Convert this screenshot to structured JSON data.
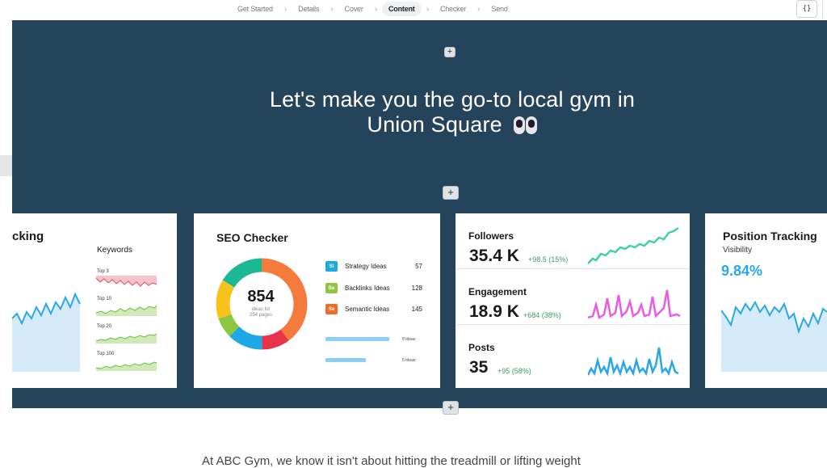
{
  "nav": {
    "steps": [
      "Get Started",
      "Details",
      "Cover",
      "Content",
      "Checker",
      "Send"
    ],
    "active_step": "Content",
    "code_button_label": "{}"
  },
  "hero": {
    "headline_line1": "Let's make you the go-to local gym in",
    "headline_line2": "Union Square",
    "emoji_icon": "eyes-icon"
  },
  "buttons": {
    "add_label": "+"
  },
  "card_tracking": {
    "title": "cking",
    "keywords_label": "Keywords",
    "minis": [
      "Top 3",
      "Top 10",
      "Top 20",
      "Top 100"
    ]
  },
  "card_seo": {
    "title": "SEO Checker",
    "total": "854",
    "total_sub_line1": "ideas for",
    "total_sub_line2": "254 pages",
    "items": [
      {
        "badge": "St",
        "label": "Strategy Ideas",
        "value": "57",
        "color": "#1da9e8"
      },
      {
        "badge": "Ba",
        "label": "Backlinks Ideas",
        "value": "128",
        "color": "#8dc63f"
      },
      {
        "badge": "Se",
        "label": "Semantic Ideas",
        "value": "145",
        "color": "#f26b2b"
      }
    ],
    "bars": [
      {
        "label": "8 Ideas",
        "fraction": 0.88
      },
      {
        "label": "5 Ideas",
        "fraction": 0.55
      }
    ]
  },
  "card_social": {
    "rows": [
      {
        "title": "Followers",
        "value": "35.4 K",
        "delta": "+98.5 (15%)",
        "color": "#3fd39a"
      },
      {
        "title": "Engagement",
        "value": "18.9 K",
        "delta": "+684 (38%)",
        "color": "#e95be7"
      },
      {
        "title": "Posts",
        "value": "35",
        "delta": "+95 (58%)",
        "color": "#2aa7e9"
      }
    ]
  },
  "card_position": {
    "title": "Position Tracking",
    "subtitle": "Visibility",
    "value": "9.84%"
  },
  "bottom_text": "At ABC Gym, we know it isn't about hitting the treadmill or lifting weight"
}
